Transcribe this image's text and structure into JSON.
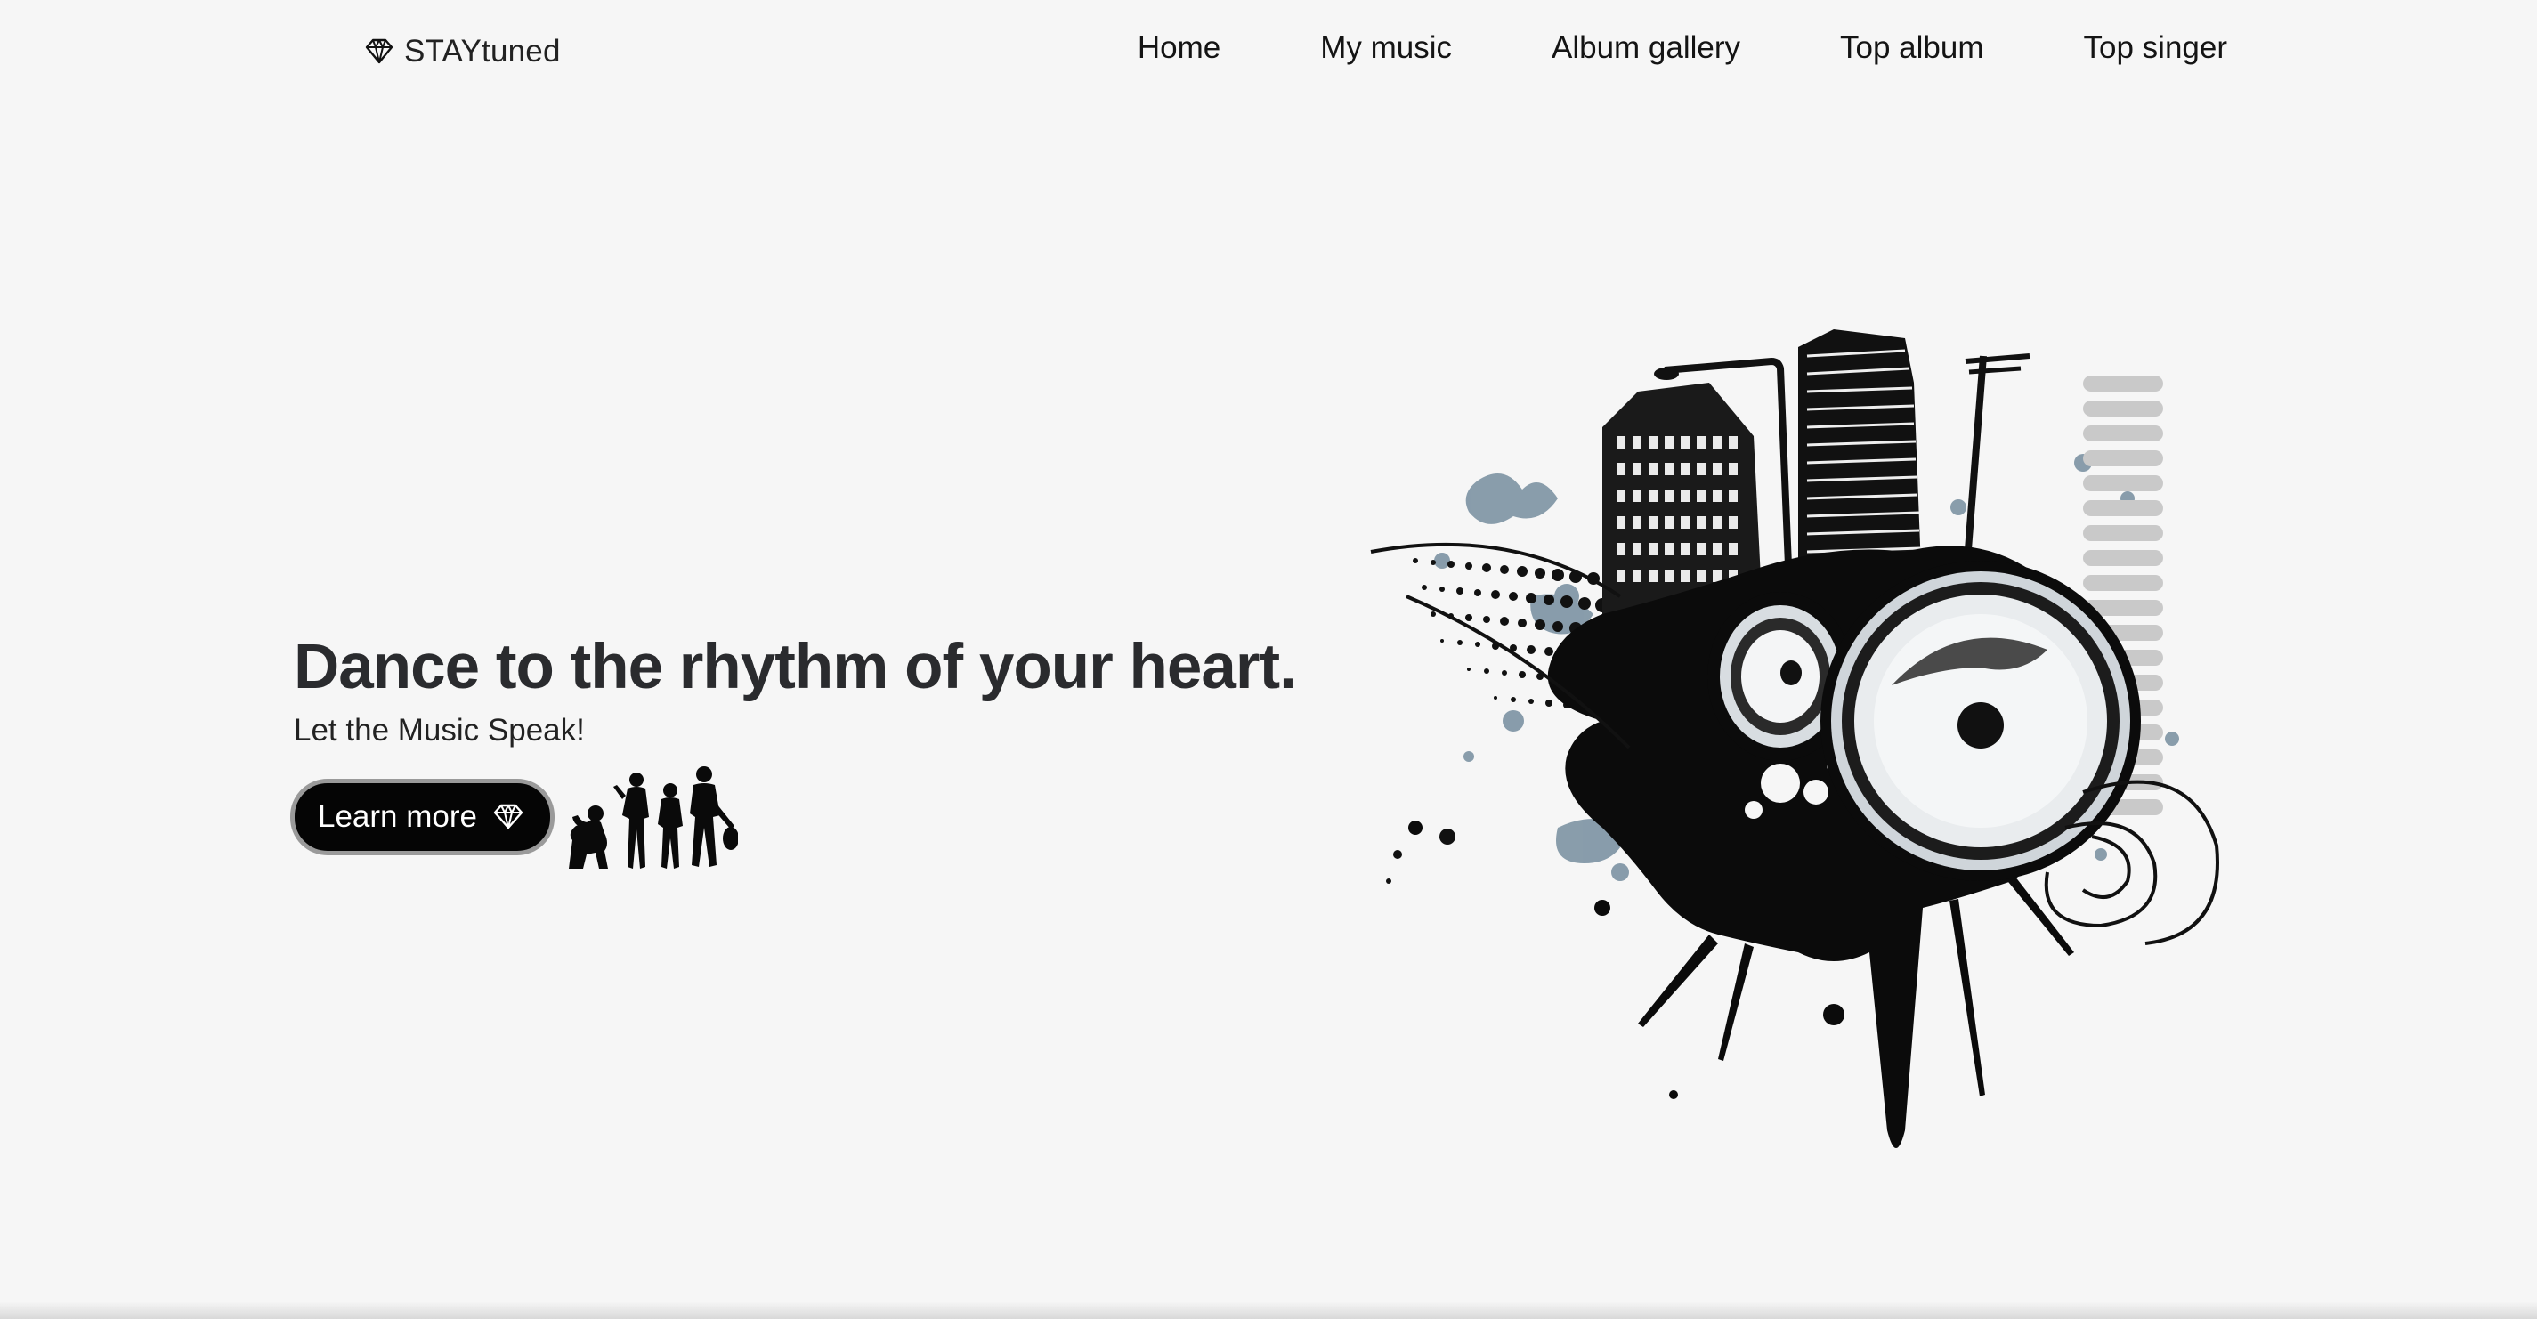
{
  "brand": {
    "name": "STAYtuned",
    "icon": "diamond-icon"
  },
  "nav": {
    "items": [
      {
        "label": "Home"
      },
      {
        "label": "My music"
      },
      {
        "label": "Album gallery"
      },
      {
        "label": "Top album"
      },
      {
        "label": "Top singer"
      }
    ]
  },
  "hero": {
    "title": "Dance to the rhythm of your heart.",
    "subtitle": "Let the Music Speak!",
    "cta_label": "Learn more",
    "cta_icon": "diamond-icon"
  },
  "colors": {
    "background": "#f6f6f6",
    "button": "#050505",
    "button_border": "#9a9a9a",
    "accent_splash": "#7d93a3"
  }
}
